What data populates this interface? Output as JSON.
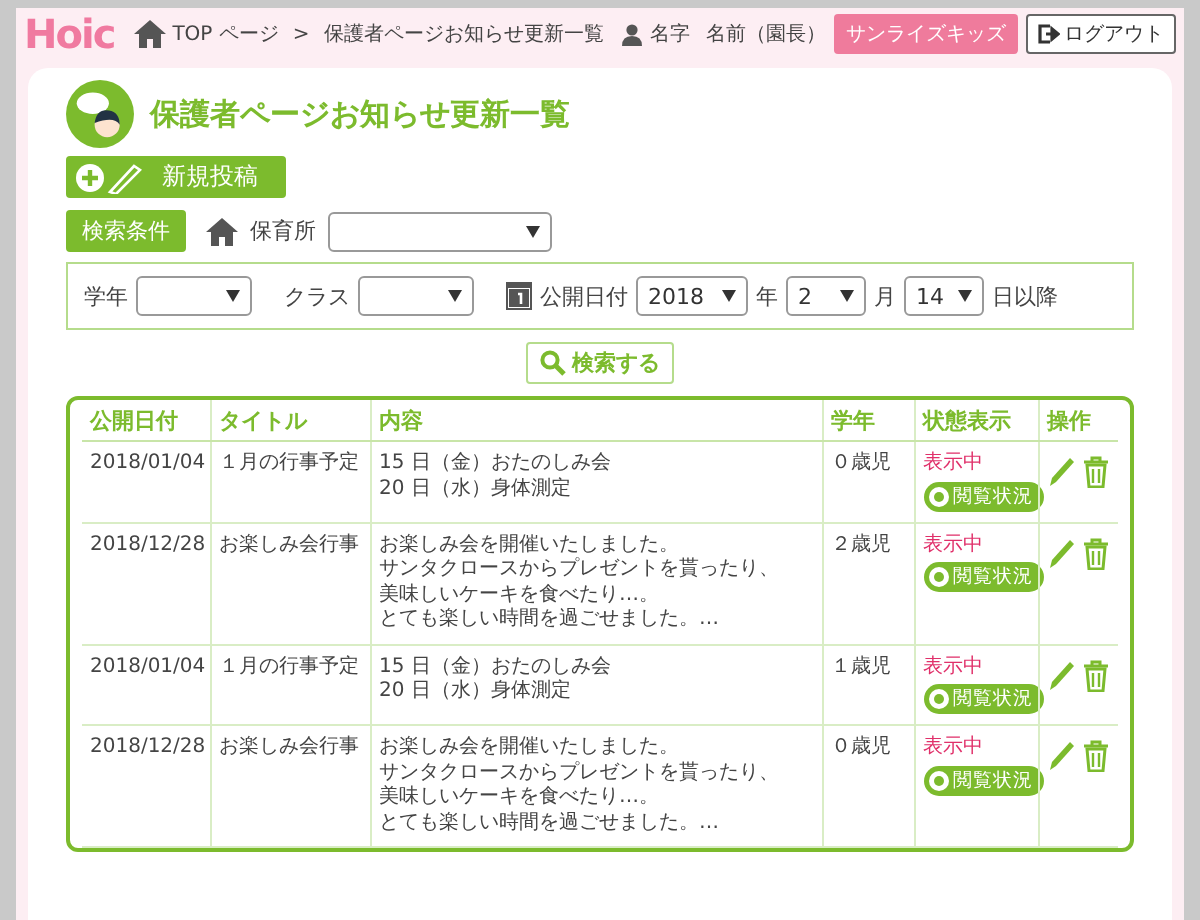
{
  "header": {
    "logo": "Hoic",
    "breadcrumbs": [
      "TOP ページ",
      "保護者ページお知らせ更新一覧"
    ],
    "breadcrumb_separator": ">",
    "user_label": "名字",
    "user_name": "名前（園長）",
    "school_badge": "サンライズキッズ",
    "logout": "ログアウト"
  },
  "page": {
    "title": "保護者ページお知らせ更新一覧",
    "new_post": "新規投稿"
  },
  "search": {
    "heading": "検索条件",
    "facility_label": "保育所",
    "grade_label": "学年",
    "class_label": "クラス",
    "date_label": "公開日付",
    "year_value": "2018",
    "year_unit": "年",
    "month_value": "2",
    "month_unit": "月",
    "day_value": "14",
    "day_unit": "日以降",
    "submit": "検索する"
  },
  "table": {
    "columns": [
      "公開日付",
      "タイトル",
      "内容",
      "学年",
      "状態表示",
      "操作"
    ],
    "rows": [
      {
        "date": "2018/01/04",
        "title": "１月の行事予定",
        "content": [
          "15 日（金）おたのしみ会",
          "20 日（水）身体測定"
        ],
        "grade": "０歳児",
        "status": "表示中",
        "view_button": "閲覧状況"
      },
      {
        "date": "2018/12/28",
        "title": "お楽しみ会行事",
        "content": [
          "お楽しみ会を開催いたしました。",
          "サンタクロースからプレゼントを貰ったり、",
          "美味しいケーキを食べたり…。",
          "とても楽しい時間を過ごせました。…"
        ],
        "grade": "２歳児",
        "status": "表示中",
        "view_button": "閲覧状況"
      },
      {
        "date": "2018/01/04",
        "title": "１月の行事予定",
        "content": [
          "15 日（金）おたのしみ会",
          "20 日（水）身体測定"
        ],
        "grade": "１歳児",
        "status": "表示中",
        "view_button": "閲覧状況"
      },
      {
        "date": "2018/12/28",
        "title": "お楽しみ会行事",
        "content": [
          "お楽しみ会を開催いたしました。",
          "サンタクロースからプレゼントを貰ったり、",
          "美味しいケーキを食べたり…。",
          "とても楽しい時間を過ごせました。…"
        ],
        "grade": "０歳児",
        "status": "表示中",
        "view_button": "閲覧状況"
      }
    ]
  }
}
